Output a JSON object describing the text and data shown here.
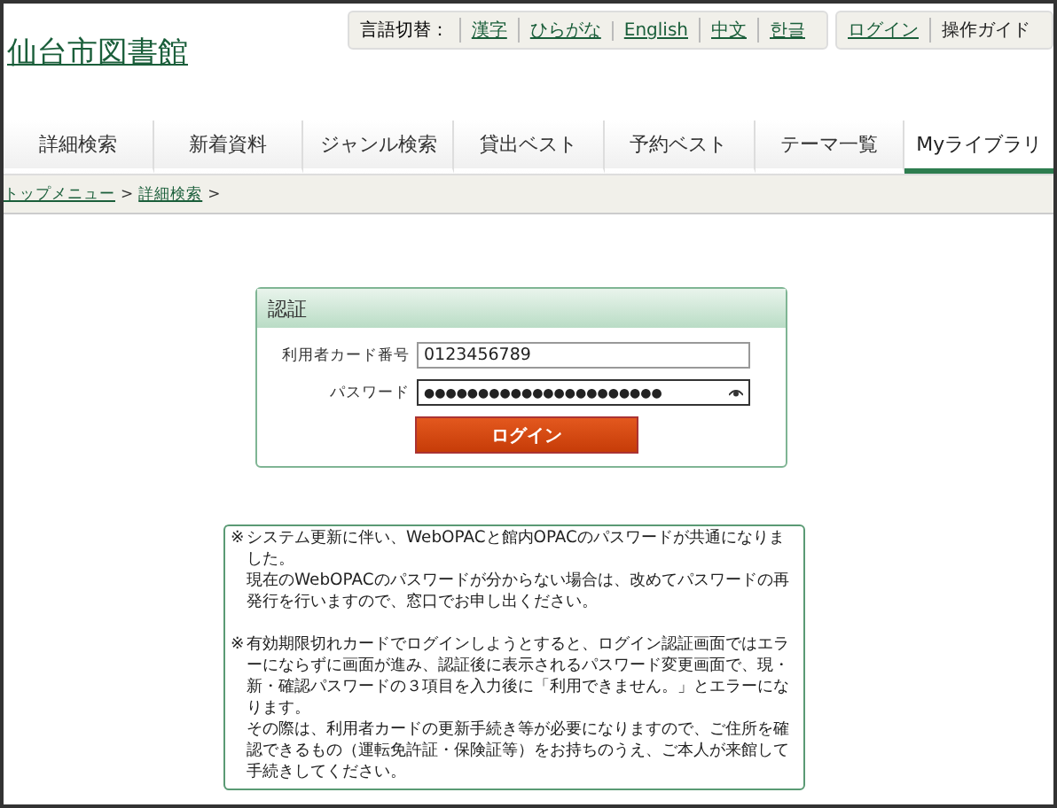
{
  "site_title": "仙台市図書館",
  "language_bar": {
    "label": "言語切替：",
    "languages": [
      {
        "label": "漢字"
      },
      {
        "label": "ひらがな"
      },
      {
        "label": "English"
      },
      {
        "label": "中文"
      },
      {
        "label": "한글"
      }
    ]
  },
  "user_links": [
    {
      "label": "ログイン",
      "kind": "link"
    },
    {
      "label": "操作ガイド",
      "kind": "text"
    }
  ],
  "tabs": [
    {
      "label": "詳細検索",
      "selected": false
    },
    {
      "label": "新着資料",
      "selected": false
    },
    {
      "label": "ジャンル検索",
      "selected": false
    },
    {
      "label": "貸出ベスト",
      "selected": false
    },
    {
      "label": "予約ベスト",
      "selected": false
    },
    {
      "label": "テーマ一覧",
      "selected": false
    },
    {
      "label": "Myライブラリ",
      "selected": true
    }
  ],
  "breadcrumb": [
    {
      "label": "トップメニュー"
    },
    {
      "label": "詳細検索"
    }
  ],
  "breadcrumb_separator": ">",
  "login": {
    "title": "認証",
    "card_label": "利用者カード番号",
    "card_value": "0123456789",
    "password_label": "パスワード",
    "password_mask": "●●●●●●●●●●●●●●●●●●●●●●",
    "button": "ログイン"
  },
  "notices": [
    {
      "mark": "※",
      "text": "システム更新に伴い、WebOPACと館内OPACのパスワードが共通になりました。",
      "more": [
        "現在のWebOPACのパスワードが分からない場合は、改めてパスワードの再発行を行いますので、窓口でお申し出ください。"
      ]
    },
    {
      "mark": "※",
      "text": "有効期限切れカードでログインしようとすると、ログイン認証画面ではエラーにならずに画面が進み、認証後に表示されるパスワード変更画面で、現・新・確認パスワードの３項目を入力後に「利用できません。」とエラーになります。",
      "more": [
        "その際は、利用者カードの更新手続き等が必要になりますので、ご住所を確認できるもの（運転免許証・保険証等）をお持ちのうえ、ご本人が来館して手続きしてください。"
      ]
    }
  ]
}
